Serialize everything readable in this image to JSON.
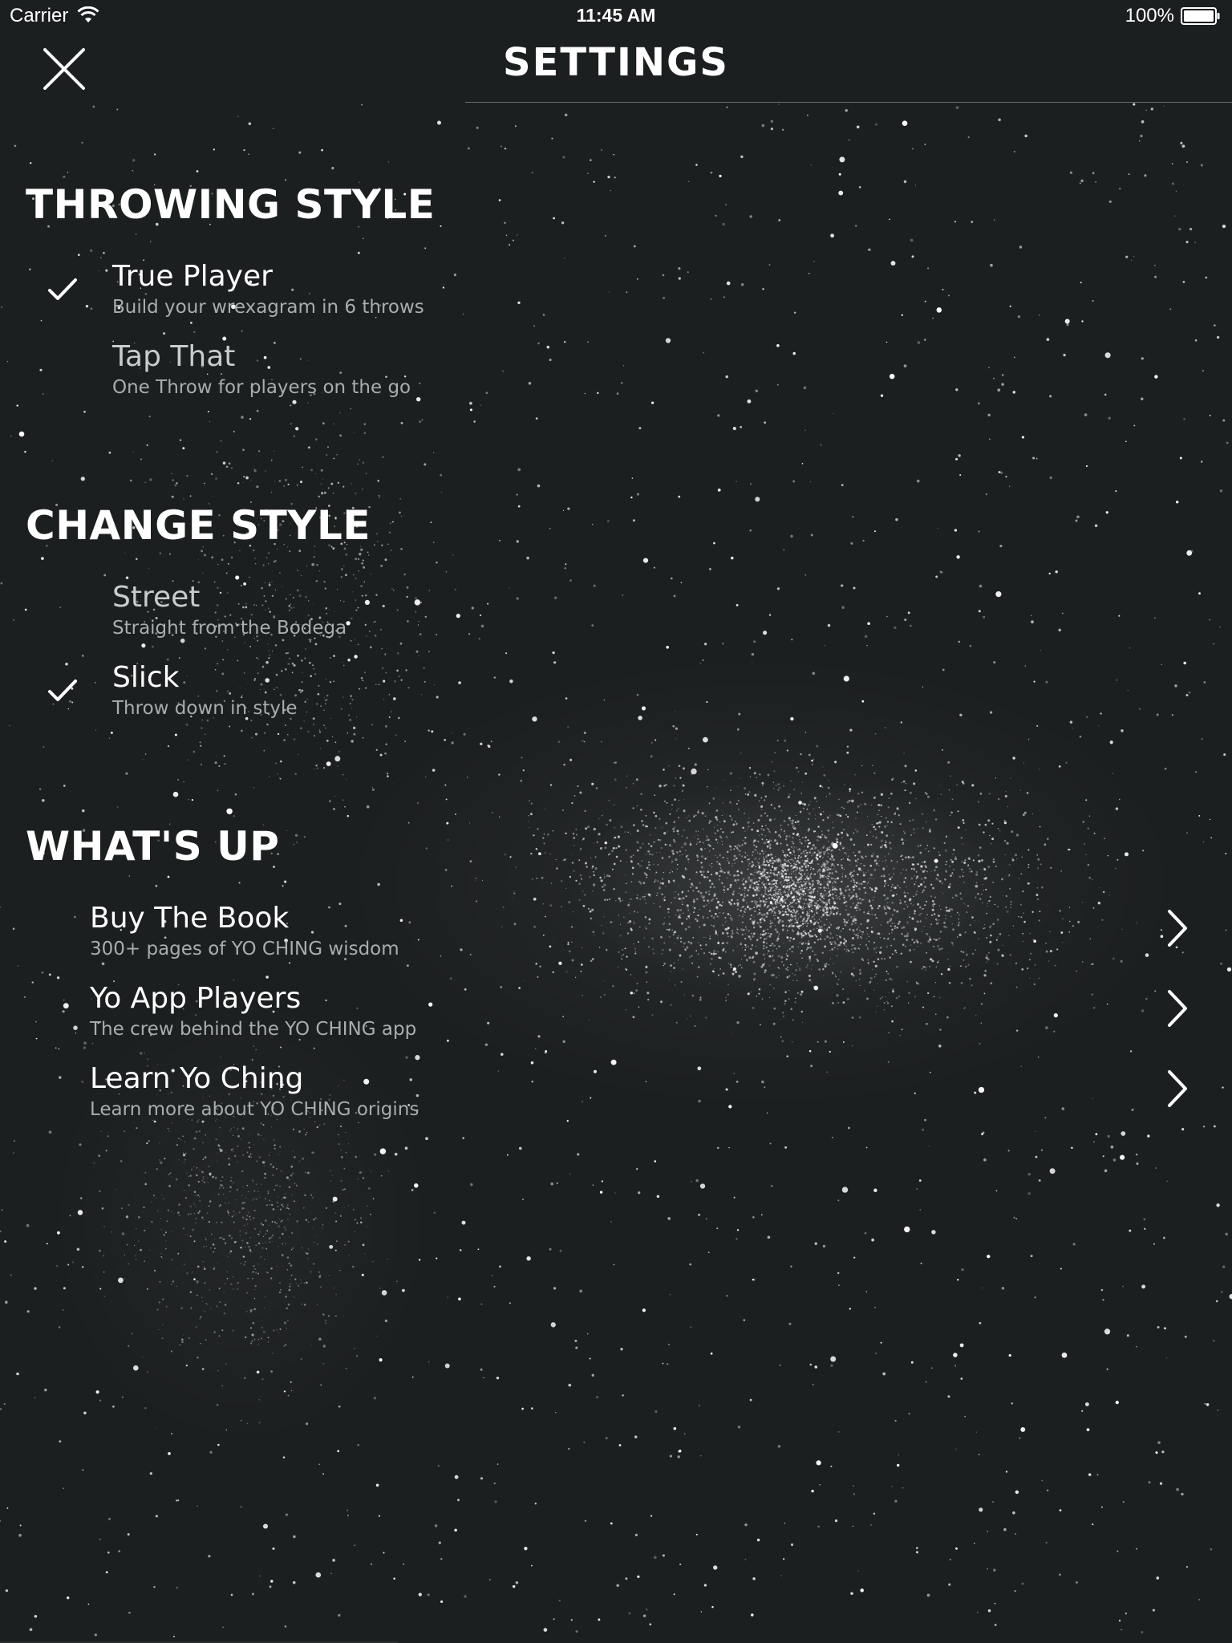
{
  "status_bar": {
    "carrier": "Carrier",
    "time": "11:45 AM",
    "battery": "100%",
    "wifi_icon": "wifi-icon",
    "battery_icon": "battery-icon"
  },
  "header": {
    "title": "SETTINGS",
    "close_icon": "close-icon"
  },
  "sections": {
    "throwing_style": {
      "heading": "THROWING STYLE",
      "options": [
        {
          "title": "True Player",
          "subtitle": "Build your wrexagram in 6 throws",
          "selected": true
        },
        {
          "title": "Tap That",
          "subtitle": "One Throw for players on the go",
          "selected": false
        }
      ]
    },
    "change_style": {
      "heading": "CHANGE STYLE",
      "options": [
        {
          "title": "Street",
          "subtitle": "Straight from the Bodega",
          "selected": false
        },
        {
          "title": "Slick",
          "subtitle": "Throw down in style",
          "selected": true
        }
      ]
    },
    "whats_up": {
      "heading": "WHAT'S UP",
      "links": [
        {
          "title": "Buy The Book",
          "subtitle": "300+ pages of YO CHING wisdom"
        },
        {
          "title": "Yo App Players",
          "subtitle": "The crew behind the YO CHING app"
        },
        {
          "title": "Learn Yo Ching",
          "subtitle": "Learn more about YO CHING origins"
        }
      ]
    }
  },
  "colors": {
    "background": "#1c1f20",
    "text": "#ffffff",
    "subtext": "#a9adaf"
  }
}
